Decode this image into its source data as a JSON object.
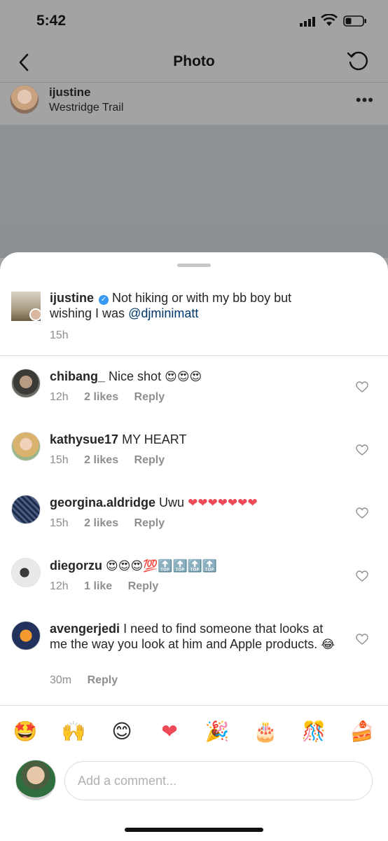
{
  "status_bar": {
    "time": "5:42"
  },
  "nav": {
    "title": "Photo"
  },
  "post": {
    "username": "ijustine",
    "location": "Westridge Trail"
  },
  "caption": {
    "username": "ijustine",
    "text_before_mention": "Not hiking or with my bb boy but wishing I was",
    "mention": "@djminimatt",
    "time": "15h"
  },
  "comments": [
    {
      "username": "chibang_",
      "text": "Nice shot",
      "emojis": "😍😍😍",
      "time": "12h",
      "likes": "2 likes",
      "reply": "Reply"
    },
    {
      "username": "kathysue17",
      "text": "MY HEART",
      "emojis": "",
      "time": "15h",
      "likes": "2 likes",
      "reply": "Reply"
    },
    {
      "username": "georgina.aldridge",
      "text": "Uwu",
      "emojis": "❤❤❤❤❤❤❤",
      "time": "15h",
      "likes": "2 likes",
      "reply": "Reply"
    },
    {
      "username": "diegorzu",
      "text": "",
      "emojis": "😍😍😍💯🔝🔝🔝🔝",
      "time": "12h",
      "likes": "1 like",
      "reply": "Reply"
    },
    {
      "username": "avengerjedi",
      "text": "I need to find someone that looks at me the way you look at him and Apple products.",
      "emojis": "😂",
      "time": "30m",
      "likes": "",
      "reply": "Reply"
    }
  ],
  "quick_emojis": [
    "🤩",
    "🙌",
    "😊",
    "❤",
    "🎉",
    "🎂",
    "🎊",
    "🍰"
  ],
  "compose": {
    "placeholder": "Add a comment..."
  },
  "colors": {
    "link": "#00376b",
    "verified": "#3897f0",
    "heart": "#ed4956",
    "meta": "#8e8e8e"
  }
}
